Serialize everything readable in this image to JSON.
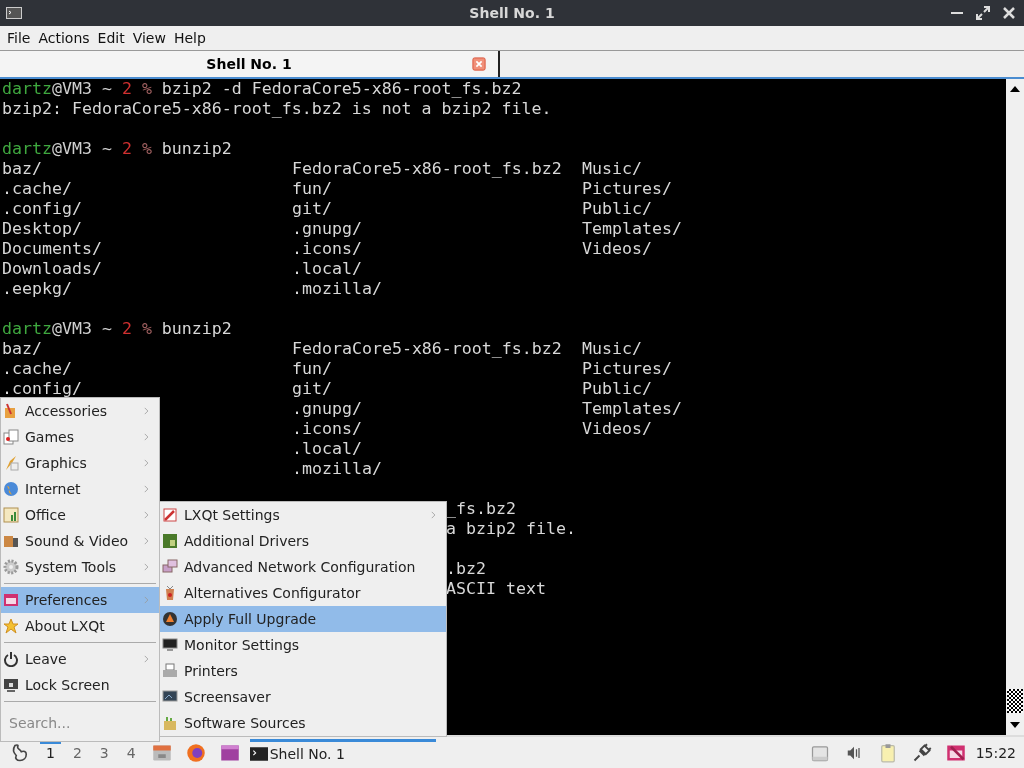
{
  "window": {
    "title": "Shell No. 1"
  },
  "menu_bar": [
    "File",
    "Actions",
    "Edit",
    "View",
    "Help"
  ],
  "tabs": [
    {
      "label": "Shell No. 1",
      "selected": true
    }
  ],
  "terminal": {
    "lines": [
      {
        "kind": "prompt",
        "user": "dartz",
        "host": "@VM3 ~ ",
        "count": "2",
        "sign": " %",
        "command": " bzip2 -d FedoraCore5-x86-root_fs.bz2"
      },
      {
        "kind": "output",
        "text": "bzip2: FedoraCore5-x86-root_fs.bz2 is not a bzip2 file."
      },
      {
        "kind": "blank"
      },
      {
        "kind": "prompt",
        "user": "dartz",
        "host": "@VM3 ~ ",
        "count": "2",
        "sign": " %",
        "command": " bunzip2"
      },
      {
        "kind": "listing",
        "column_1": "baz/",
        "column_2": "FedoraCore5-x86-root_fs.bz2",
        "column_3": "Music/"
      },
      {
        "kind": "listing",
        "column_1": ".cache/",
        "column_2": "fun/",
        "column_3": "Pictures/"
      },
      {
        "kind": "listing",
        "column_1": ".config/",
        "column_2": "git/",
        "column_3": "Public/"
      },
      {
        "kind": "listing",
        "column_1": "Desktop/",
        "column_2": ".gnupg/",
        "column_3": "Templates/"
      },
      {
        "kind": "listing",
        "column_1": "Documents/",
        "column_2": ".icons/",
        "column_3": "Videos/"
      },
      {
        "kind": "listing",
        "column_1": "Downloads/",
        "column_2": ".local/"
      },
      {
        "kind": "listing",
        "column_1": ".eepkg/",
        "column_2": ".mozilla/"
      },
      {
        "kind": "blank"
      },
      {
        "kind": "prompt",
        "user": "dartz",
        "host": "@VM3 ~ ",
        "count": "2",
        "sign": " %",
        "command": " bunzip2"
      },
      {
        "kind": "listing",
        "column_1": "baz/",
        "column_2": "FedoraCore5-x86-root_fs.bz2",
        "column_3": "Music/"
      },
      {
        "kind": "listing",
        "column_1": ".cache/",
        "column_2": "fun/",
        "column_3": "Pictures/"
      },
      {
        "kind": "listing",
        "column_1": ".config/",
        "column_2": "git/",
        "column_3": "Public/"
      },
      {
        "kind": "listing",
        "column_2": ".gnupg/",
        "column_3": "Templates/"
      },
      {
        "kind": "listing",
        "column_2": ".icons/",
        "column_3": "Videos/"
      },
      {
        "kind": "listing",
        "column_2": ".local/"
      },
      {
        "kind": "listing",
        "column_2": ".mozilla/"
      },
      {
        "kind": "blank"
      },
      {
        "kind": "partial",
        "text": "_fs.bz2"
      },
      {
        "kind": "partial",
        "text": "a bzip2 file."
      },
      {
        "kind": "blank"
      },
      {
        "kind": "partial",
        "text": ".bz2"
      },
      {
        "kind": "partial",
        "text": "ASCII text"
      }
    ]
  },
  "start_menu": {
    "sections": [
      [
        {
          "label": "Accessories",
          "submenu": true,
          "selected": false
        },
        {
          "label": "Games",
          "submenu": true,
          "selected": false
        },
        {
          "label": "Graphics",
          "submenu": true,
          "selected": false
        },
        {
          "label": "Internet",
          "submenu": true,
          "selected": false
        },
        {
          "label": "Office",
          "submenu": true,
          "selected": false
        },
        {
          "label": "Sound & Video",
          "submenu": true,
          "selected": false
        },
        {
          "label": "System Tools",
          "submenu": true,
          "selected": false
        }
      ],
      [
        {
          "label": "Preferences",
          "submenu": true,
          "selected": true
        },
        {
          "label": "About LXQt",
          "submenu": false,
          "selected": false
        }
      ],
      [
        {
          "label": "Leave",
          "submenu": true,
          "selected": false
        },
        {
          "label": "Lock Screen",
          "submenu": false,
          "selected": false
        }
      ]
    ],
    "search": {
      "placeholder": "Search..."
    }
  },
  "submenu": {
    "items": [
      {
        "label": "LXQt Settings",
        "submenu": true,
        "selected": false
      },
      {
        "label": "Additional Drivers",
        "submenu": false,
        "selected": false
      },
      {
        "label": "Advanced Network Configuration",
        "submenu": false,
        "selected": false
      },
      {
        "label": "Alternatives Configurator",
        "submenu": false,
        "selected": false
      },
      {
        "label": "Apply Full Upgrade",
        "submenu": false,
        "selected": true
      },
      {
        "label": "Monitor Settings",
        "submenu": false,
        "selected": false
      },
      {
        "label": "Printers",
        "submenu": false,
        "selected": false
      },
      {
        "label": "Screensaver",
        "submenu": false,
        "selected": false
      },
      {
        "label": "Software Sources",
        "submenu": false,
        "selected": false
      }
    ]
  },
  "taskbar": {
    "desktops": [
      {
        "label": "1",
        "selected": true
      },
      {
        "label": "2",
        "selected": false
      },
      {
        "label": "3",
        "selected": false
      },
      {
        "label": "4",
        "selected": false
      }
    ],
    "tasks": [
      {
        "label": "Shell No. 1",
        "selected": true
      }
    ],
    "clock": "15:22"
  }
}
